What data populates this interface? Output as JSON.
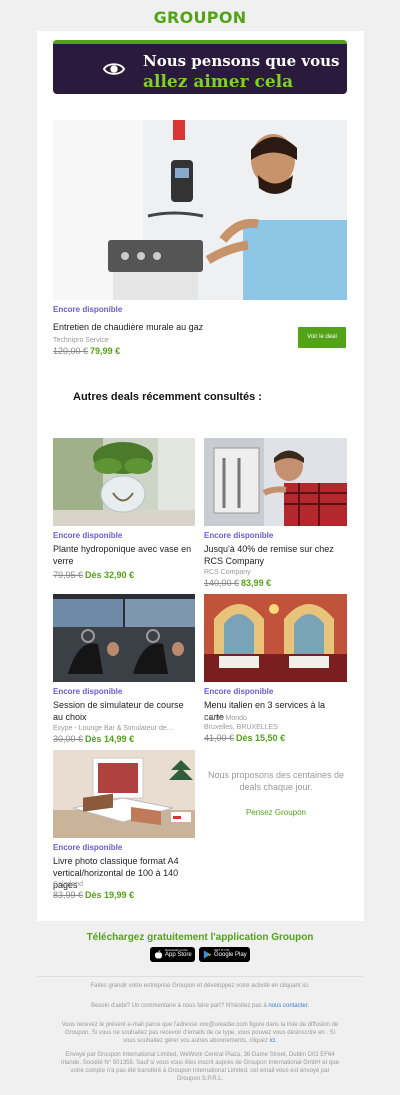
{
  "brand": {
    "logo": "GROUPON"
  },
  "hero": {
    "line1": "Nous pensons que vous",
    "line2": "allez aimer cela"
  },
  "main_deal": {
    "availability": "Encore disponible",
    "title": "Entretien de chaudière murale au gaz",
    "merchant": "Technipro Service",
    "old_price": "120,00 €",
    "new_price": "79,99 €",
    "button": "Voir le deal"
  },
  "section_title": "Autres deals récemment consultés :",
  "deals": [
    {
      "availability": "Encore disponible",
      "title": "Plante hydroponique avec vase en verre",
      "merchant": "",
      "merchant2": "",
      "old_price": "79,95 €",
      "new_price": "Dès 32,90 €"
    },
    {
      "availability": "Encore disponible",
      "title": "Jusqu'à 40% de remise sur chez RCS Company",
      "merchant": "RCS Company",
      "merchant2": "",
      "old_price": "140,00 €",
      "new_price": "83,99 €"
    },
    {
      "availability": "Encore disponible",
      "title": "Session de simulateur de course au choix",
      "merchant": "Exype - Lounge Bar & Simulateur de...",
      "merchant2": "",
      "old_price": "30,00 €",
      "new_price": "Dès 14,99 €"
    },
    {
      "availability": "Encore disponible",
      "title": "Menu italien en 3 services à la carte",
      "merchant": "L Altro Mondo",
      "merchant2": "Bruxelles, BRUXELLES",
      "old_price": "41,00 €",
      "new_price": "Dès 15,50 €"
    },
    {
      "availability": "Encore disponible",
      "title": "Livre photo classique format A4 vertical/horizontal de 100 à 140 pages",
      "merchant": "Colorland",
      "merchant2": "",
      "old_price": "83,99 €",
      "new_price": "Dès 19,99 €"
    }
  ],
  "promo": {
    "text": "Nous proposons des centaines de deals chaque jour.",
    "link": "Pensez Groupon"
  },
  "app": {
    "title": "Téléchargez gratuitement l'application Groupon",
    "appstore_small": "Download on the",
    "appstore_big": "App Store",
    "googleplay_small": "GET IT ON",
    "googleplay_big": "Google Play"
  },
  "footer": {
    "line1": "Faites grandir votre entreprise Groupon et développez votre activité en cliquant ici.",
    "help": "Besoin d'aide? Un commentaire à nous faire part? N'hésitez pas à",
    "help_link": "nous contacter",
    "help_end": ".",
    "legal": "Vous recevez le présent e-mail parce que l'adresse xxx@ureader.com figure dans la liste de diffusion de Groupon. Si vous ne souhaitez pas recevoir d'emails de ce type, vous pouvez vous désinscrire en . Si vous souhaitez gérer vos autres abonnements, cliquez",
    "legal_link": "ici",
    "legal_end": ".",
    "address": "Envoyé par Groupon International Limited, WeWork Central Plaza, 36 Dame Street, Dublin D02 EF64 Irlande. Société N° 501358. Sauf si vous vous êtes inscrit auprès de Groupon International GmbH et que votre compte n'a pas été transféré à Groupon International Limited, cet email vous est envoyé par Groupon S.P.R.L."
  },
  "colors": {
    "brand_green": "#53a318",
    "hero_bg": "#2a1b3d",
    "tag_purple": "#6b5bd6"
  }
}
